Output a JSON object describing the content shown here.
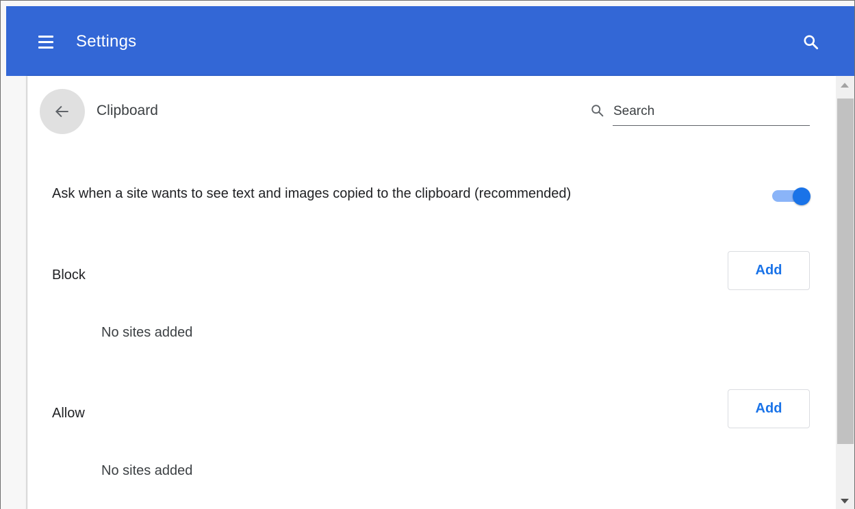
{
  "header": {
    "title": "Settings",
    "menu_icon": "hamburger-menu-icon",
    "search_icon": "search-icon",
    "bg_color": "#3367d6"
  },
  "page": {
    "back_icon": "arrow-left-icon",
    "title": "Clipboard",
    "search": {
      "icon": "search-icon",
      "placeholder": "Search",
      "value": ""
    }
  },
  "setting": {
    "label": "Ask when a site wants to see text and images copied to the clipboard (recommended)",
    "enabled": true,
    "accent_color": "#1a73e8"
  },
  "sections": [
    {
      "heading": "Block",
      "add_label": "Add",
      "empty_text": "No sites added"
    },
    {
      "heading": "Allow",
      "add_label": "Add",
      "empty_text": "No sites added"
    }
  ]
}
